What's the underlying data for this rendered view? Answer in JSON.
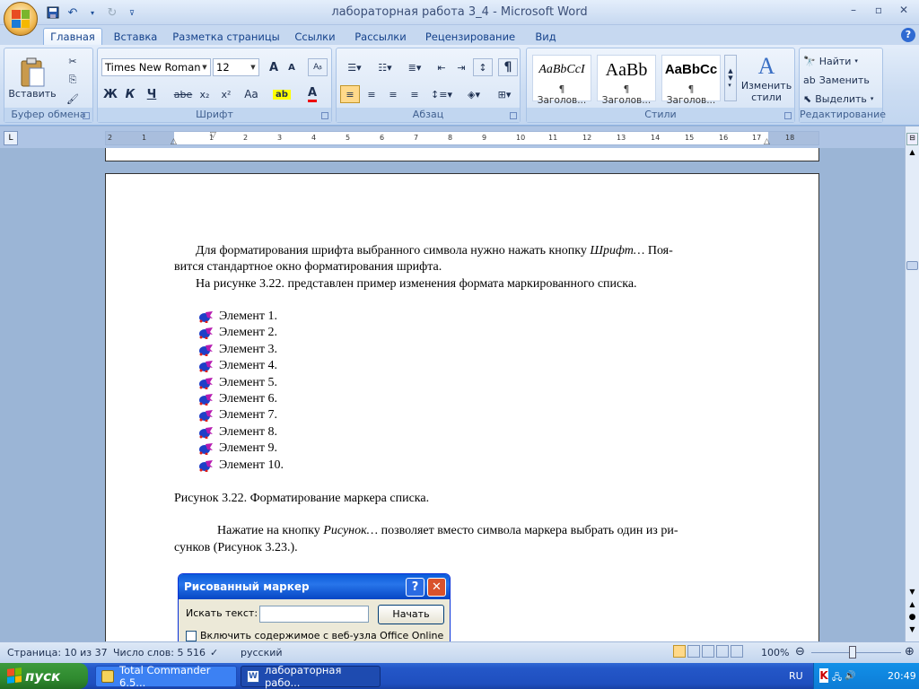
{
  "window": {
    "title": "лабораторная работа 3_4 - Microsoft Word",
    "minimize": "–",
    "maximize": "▫",
    "close": "✕"
  },
  "ribbon_tabs": [
    "Главная",
    "Вставка",
    "Разметка страницы",
    "Ссылки",
    "Рассылки",
    "Рецензирование",
    "Вид"
  ],
  "clipboard": {
    "paste_label": "Вставить",
    "group_label": "Буфер обмена"
  },
  "font": {
    "name": "Times New Roman",
    "size": "12",
    "bold": "Ж",
    "italic": "К",
    "underline": "Ч",
    "strike": "abe",
    "sub": "x₂",
    "sup": "x²",
    "case": "Aa",
    "grow": "A",
    "shrink": "A",
    "group_label": "Шрифт"
  },
  "paragraph": {
    "group_label": "Абзац",
    "show_marks": "¶"
  },
  "styles": {
    "items": [
      {
        "sample": "AaBbCcI",
        "name": "¶ Заголов..."
      },
      {
        "sample": "AaBb",
        "name": "¶ Заголов..."
      },
      {
        "sample": "AaBbCc",
        "name": "¶ Заголов..."
      }
    ],
    "change_label_1": "Изменить",
    "change_label_2": "стили",
    "group_label": "Стили"
  },
  "editing": {
    "find": "Найти",
    "replace": "Заменить",
    "select": "Выделить",
    "group_label": "Редактирование"
  },
  "ruler_marks": [
    "2",
    "1",
    "1",
    "2",
    "3",
    "4",
    "5",
    "6",
    "7",
    "8",
    "9",
    "10",
    "11",
    "12",
    "13",
    "14",
    "15",
    "16",
    "17",
    "18"
  ],
  "document": {
    "p1_a": "Для форматирования шрифта выбранного символа нужно нажать кнопку",
    "p1_italic": "Шрифт…",
    "p1_b": "Поя-",
    "p1_line2": "вится стандартное окно форматирования шрифта.",
    "p2": "На рисунке 3.22. представлен пример изменения формата маркированного списка.",
    "list": [
      "Элемент 1.",
      "Элемент 2.",
      "Элемент 3.",
      "Элемент 4.",
      "Элемент 5.",
      "Элемент 6.",
      "Элемент 7.",
      "Элемент 8.",
      "Элемент 9.",
      "Элемент 10."
    ],
    "caption": "Рисунок 3.22. Форматирование маркера списка.",
    "p3_a": "Нажатие на кнопку",
    "p3_italic": "Рисунок…",
    "p3_b": "позволяет вместо символа маркера выбрать один из ри-",
    "p3_line2": "сунков (Рисунок 3.23.)."
  },
  "dialog": {
    "title": "Рисованный маркер",
    "help": "?",
    "close": "✕",
    "search_label": "Искать текст:",
    "search_value": "",
    "start_button": "Начать",
    "checkbox_label": "Включить содержимое с веб-узла Office Online"
  },
  "status": {
    "page": "Страница: 10 из 37",
    "words": "Число слов: 5 516",
    "lang": "русский",
    "zoom": "100%"
  },
  "taskbar": {
    "start": "пуск",
    "items": [
      "Total Commander 6.5...",
      "лабораторная рабо..."
    ],
    "lang": "RU",
    "time": "20:49"
  },
  "colors": {
    "accent": "#15428b",
    "ribbon_bg": "#c6d8f0",
    "taskbar": "#2457c8"
  }
}
